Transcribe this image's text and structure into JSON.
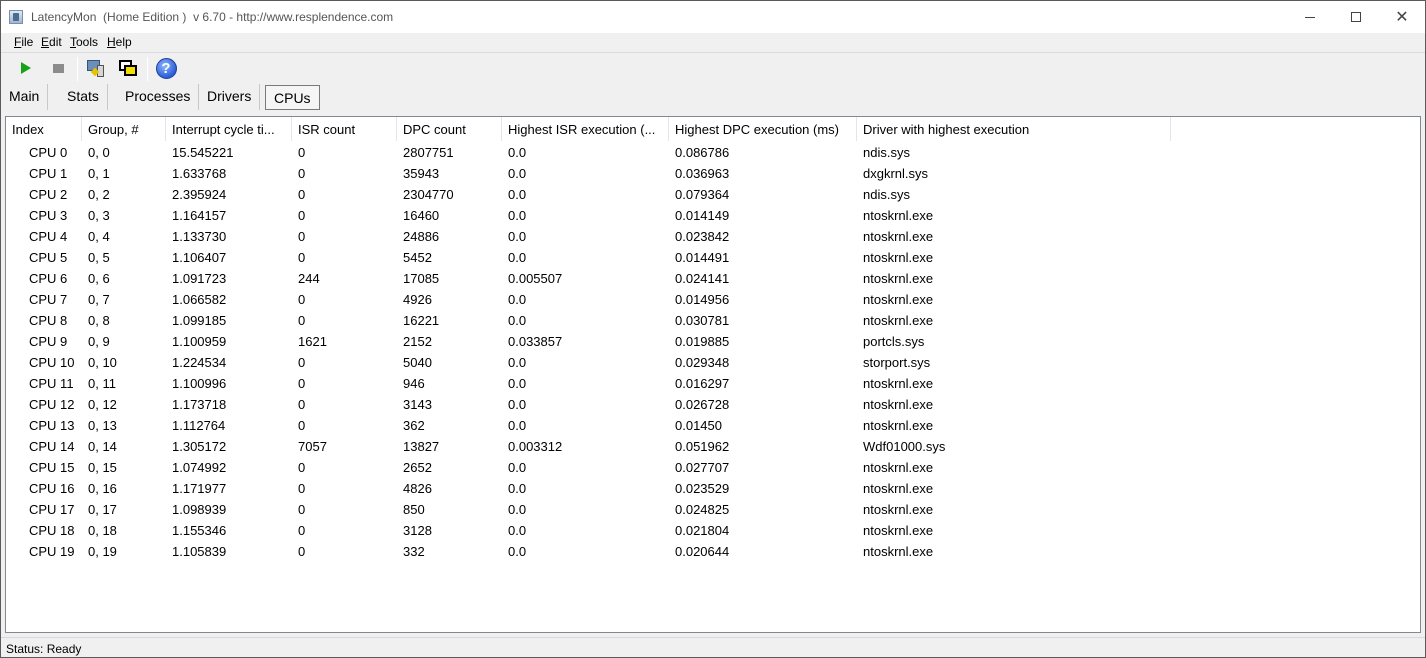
{
  "window": {
    "title": "LatencyMon  (Home Edition )  v 6.70 - http://www.resplendence.com"
  },
  "menu": [
    {
      "label": "File",
      "u": "F",
      "rest": "ile"
    },
    {
      "label": "Edit",
      "u": "E",
      "rest": "dit"
    },
    {
      "label": "Tools",
      "u": "T",
      "rest": "ools"
    },
    {
      "label": "Help",
      "u": "H",
      "rest": "elp"
    }
  ],
  "toolbar": {
    "icons": [
      "play-icon",
      "stop-icon",
      "computer-icon",
      "windows-icon",
      "help-icon"
    ],
    "help_glyph": "?"
  },
  "tabs": [
    {
      "label": "Main",
      "active": false
    },
    {
      "label": "Stats",
      "active": false
    },
    {
      "label": "Processes",
      "active": false
    },
    {
      "label": "Drivers",
      "active": false
    },
    {
      "label": "CPUs",
      "active": true
    }
  ],
  "table": {
    "columns": [
      "Index",
      "Group, #",
      "Interrupt cycle ti...",
      "ISR count",
      "DPC count",
      "Highest ISR execution (...",
      "Highest DPC execution (ms)",
      "Driver with highest execution"
    ],
    "rows": [
      [
        "CPU 0",
        "0, 0",
        "15.545221",
        "0",
        "2807751",
        "0.0",
        "0.086786",
        "ndis.sys"
      ],
      [
        "CPU 1",
        "0, 1",
        "1.633768",
        "0",
        "35943",
        "0.0",
        "0.036963",
        "dxgkrnl.sys"
      ],
      [
        "CPU 2",
        "0, 2",
        "2.395924",
        "0",
        "2304770",
        "0.0",
        "0.079364",
        "ndis.sys"
      ],
      [
        "CPU 3",
        "0, 3",
        "1.164157",
        "0",
        "16460",
        "0.0",
        "0.014149",
        "ntoskrnl.exe"
      ],
      [
        "CPU 4",
        "0, 4",
        "1.133730",
        "0",
        "24886",
        "0.0",
        "0.023842",
        "ntoskrnl.exe"
      ],
      [
        "CPU 5",
        "0, 5",
        "1.106407",
        "0",
        "5452",
        "0.0",
        "0.014491",
        "ntoskrnl.exe"
      ],
      [
        "CPU 6",
        "0, 6",
        "1.091723",
        "244",
        "17085",
        "0.005507",
        "0.024141",
        "ntoskrnl.exe"
      ],
      [
        "CPU 7",
        "0, 7",
        "1.066582",
        "0",
        "4926",
        "0.0",
        "0.014956",
        "ntoskrnl.exe"
      ],
      [
        "CPU 8",
        "0, 8",
        "1.099185",
        "0",
        "16221",
        "0.0",
        "0.030781",
        "ntoskrnl.exe"
      ],
      [
        "CPU 9",
        "0, 9",
        "1.100959",
        "1621",
        "2152",
        "0.033857",
        "0.019885",
        "portcls.sys"
      ],
      [
        "CPU 10",
        "0, 10",
        "1.224534",
        "0",
        "5040",
        "0.0",
        "0.029348",
        "storport.sys"
      ],
      [
        "CPU 11",
        "0, 11",
        "1.100996",
        "0",
        "946",
        "0.0",
        "0.016297",
        "ntoskrnl.exe"
      ],
      [
        "CPU 12",
        "0, 12",
        "1.173718",
        "0",
        "3143",
        "0.0",
        "0.026728",
        "ntoskrnl.exe"
      ],
      [
        "CPU 13",
        "0, 13",
        "1.112764",
        "0",
        "362",
        "0.0",
        "0.01450",
        "ntoskrnl.exe"
      ],
      [
        "CPU 14",
        "0, 14",
        "1.305172",
        "7057",
        "13827",
        "0.003312",
        "0.051962",
        "Wdf01000.sys"
      ],
      [
        "CPU 15",
        "0, 15",
        "1.074992",
        "0",
        "2652",
        "0.0",
        "0.027707",
        "ntoskrnl.exe"
      ],
      [
        "CPU 16",
        "0, 16",
        "1.171977",
        "0",
        "4826",
        "0.0",
        "0.023529",
        "ntoskrnl.exe"
      ],
      [
        "CPU 17",
        "0, 17",
        "1.098939",
        "0",
        "850",
        "0.0",
        "0.024825",
        "ntoskrnl.exe"
      ],
      [
        "CPU 18",
        "0, 18",
        "1.155346",
        "0",
        "3128",
        "0.0",
        "0.021804",
        "ntoskrnl.exe"
      ],
      [
        "CPU 19",
        "0, 19",
        "1.105839",
        "0",
        "332",
        "0.0",
        "0.020644",
        "ntoskrnl.exe"
      ]
    ]
  },
  "status": {
    "text": "Status: Ready"
  }
}
